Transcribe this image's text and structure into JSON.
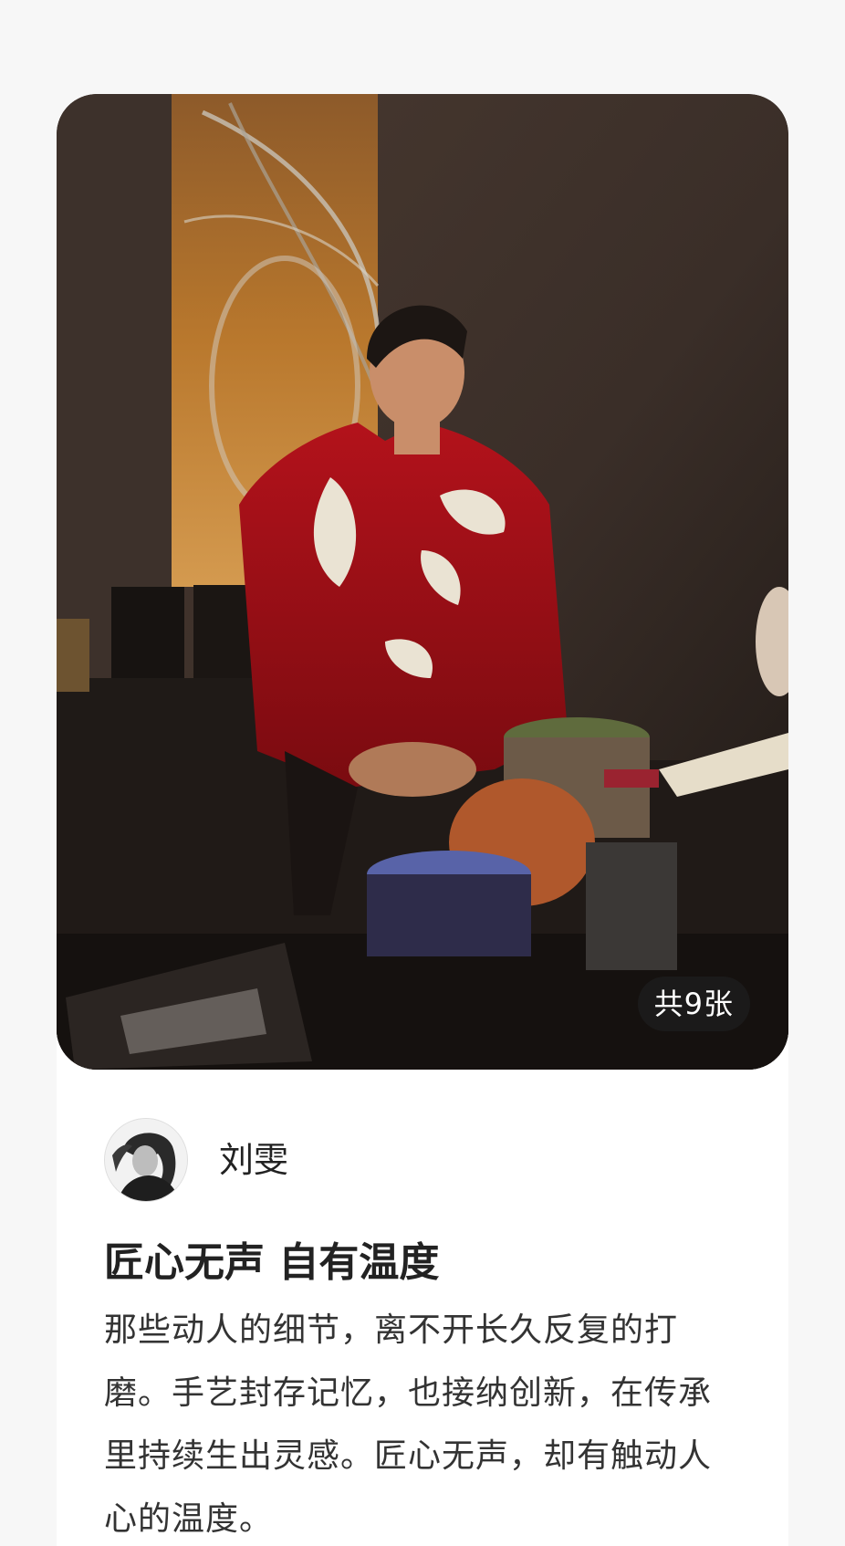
{
  "post": {
    "image_count_label": "共9张",
    "author_name": "刘雯",
    "title": "匠心无声 自有温度",
    "body": "那些动人的细节，离不开长久反复的打磨。手艺封存记忆，也接纳创新，在传承里持续生出灵感。匠心无声，却有触动人心的温度。"
  },
  "colors": {
    "page_background": "#f7f7f7",
    "card_background": "#ffffff",
    "badge_background": "#1e1e1e",
    "title_text": "#222222",
    "body_text": "#333333"
  },
  "icons": {
    "avatar": "author-avatar-photo"
  }
}
